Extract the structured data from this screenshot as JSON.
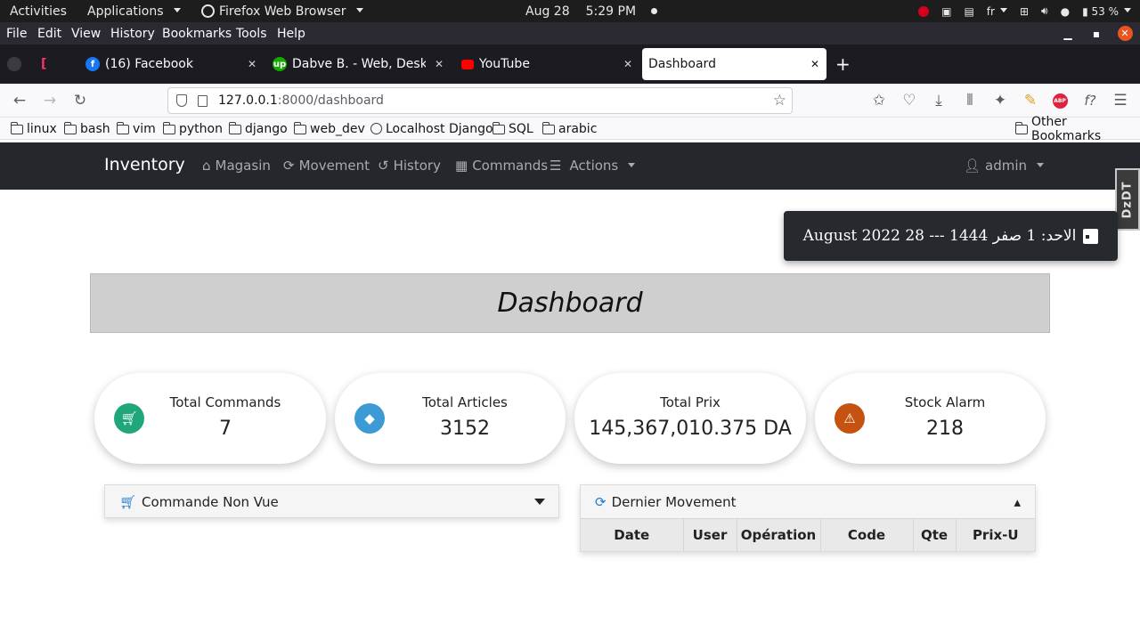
{
  "gnome": {
    "activities": "Activities",
    "applications": "Applications",
    "app_name": "Firefox Web Browser",
    "date": "Aug 28",
    "time": "5:29 PM",
    "keyboard": "fr",
    "battery": "53 %"
  },
  "menubar": {
    "items": [
      "File",
      "Edit",
      "View",
      "History",
      "Bookmarks",
      "Tools",
      "Help"
    ],
    "mnemonics": [
      "F",
      "E",
      "V",
      "s",
      "B",
      "T",
      "H"
    ]
  },
  "tabs": [
    {
      "label": "(16) Facebook",
      "favicon_color": "#1877f2"
    },
    {
      "label": "Dabve B. - Web, Desktop",
      "favicon_color": "#14a800"
    },
    {
      "label": "YouTube",
      "favicon_color": "#ff0000"
    },
    {
      "label": "Dashboard",
      "active": true
    }
  ],
  "navbar": {
    "url_host": "127.0.0.1",
    "url_path": ":8000/dashboard"
  },
  "bookmarks": {
    "items": [
      "linux",
      "bash",
      "vim",
      "python",
      "django",
      "web_dev",
      "Localhost Django",
      "SQL",
      "arabic"
    ],
    "other": "Other Bookmarks"
  },
  "app": {
    "brand": "Inventory",
    "nav": [
      "Magasin",
      "Movement",
      "History",
      "Commands",
      "Actions"
    ],
    "user": "admin",
    "date_banner": "الاحد: 1 صفر 1444 --- 28 August 2022",
    "ext_badge": "DzDT",
    "page_title": "Dashboard",
    "stats": [
      {
        "label": "Total Commands",
        "value": "7",
        "icon": "cart-icon",
        "color": "#1fa67a"
      },
      {
        "label": "Total Articles",
        "value": "3152",
        "icon": "tag-icon",
        "color": "#3c9ad4"
      },
      {
        "label": "Total Prix",
        "value": "145,367,010.375 DA"
      },
      {
        "label": "Stock Alarm",
        "value": "218",
        "icon": "warning-icon",
        "color": "#c5520f"
      }
    ],
    "panel_commandes": {
      "title": "Commande Non Vue"
    },
    "panel_movement": {
      "title": "Dernier Movement",
      "columns": [
        "Date",
        "User",
        "Opération",
        "Code",
        "Qte",
        "Prix-U"
      ]
    }
  },
  "colors": {
    "gnome_bar": "#1d1d1d",
    "firefox_chrome": "#2b2a33",
    "app_navbar": "#24272b",
    "link_blue": "#1f7ad1"
  }
}
